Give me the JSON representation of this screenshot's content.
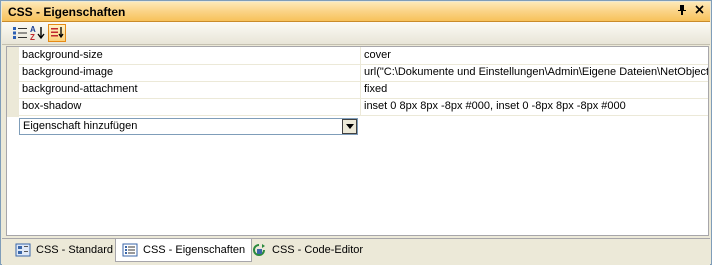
{
  "window": {
    "title": "CSS - Eigenschaften",
    "pin_glyph": "ᵖ",
    "close_glyph": "×"
  },
  "toolbar": {
    "buttons": [
      {
        "icon": "categorized-icon",
        "active": false
      },
      {
        "icon": "sort-az-icon",
        "active": false
      },
      {
        "icon": "sort-order-icon",
        "active": true
      }
    ]
  },
  "properties": [
    {
      "name": "background-size",
      "value": "cover"
    },
    {
      "name": "background-image",
      "value": "url(\"C:\\Dokumente und Einstellungen\\Admin\\Eigene Dateien\\NetObjects"
    },
    {
      "name": "background-attachment",
      "value": "fixed"
    },
    {
      "name": "box-shadow",
      "value": "inset 0 8px 8px -8px #000, inset 0 -8px 8px -8px #000"
    }
  ],
  "add_property": {
    "selected": "Eigenschaft hinzufügen"
  },
  "tabs": [
    {
      "label": "CSS - Standard",
      "icon": "css-standard-icon",
      "selected": false
    },
    {
      "label": "CSS - Eigenschaften",
      "icon": "css-properties-icon",
      "selected": true
    },
    {
      "label": "CSS - Code-Editor",
      "icon": "code-editor-icon",
      "selected": false
    }
  ]
}
